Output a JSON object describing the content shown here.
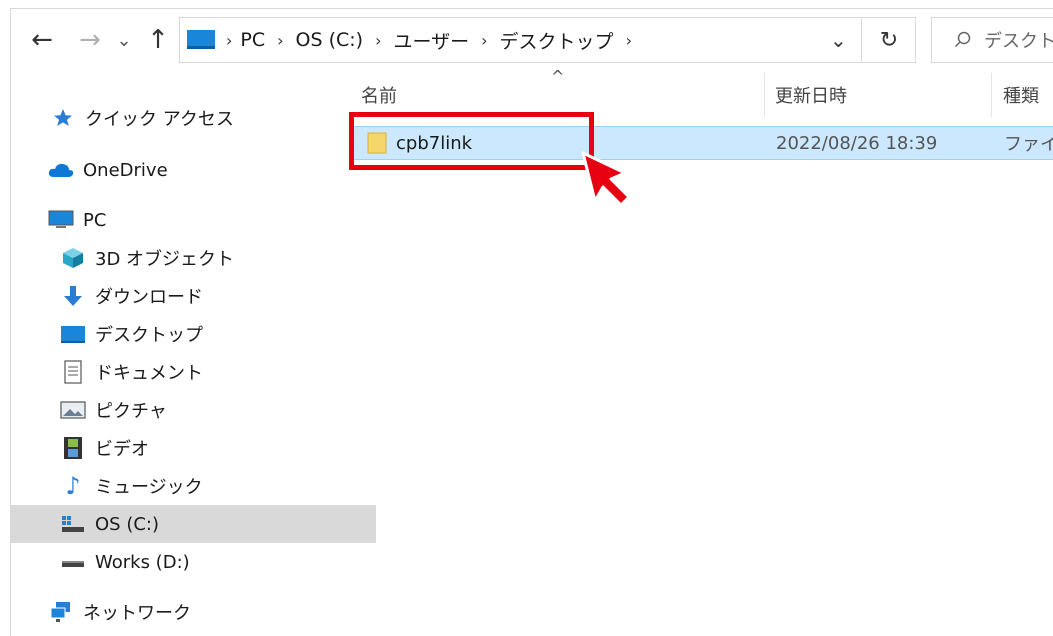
{
  "toolbar": {
    "back_label": "←",
    "forward_label": "→",
    "recent_label": "⌄",
    "up_label": "↑"
  },
  "address": {
    "crumbs": [
      "PC",
      "OS (C:)",
      "ユーザー",
      "デスクトップ"
    ],
    "dropdown_label": "⌄",
    "refresh_label": "↻"
  },
  "search": {
    "placeholder": "デスクト"
  },
  "sidebar": {
    "items": [
      {
        "label": "クイック アクセス"
      },
      {
        "label": "OneDrive"
      },
      {
        "label": "PC"
      },
      {
        "label": "3D オブジェクト"
      },
      {
        "label": "ダウンロード"
      },
      {
        "label": "デスクトップ"
      },
      {
        "label": "ドキュメント"
      },
      {
        "label": "ピクチャ"
      },
      {
        "label": "ビデオ"
      },
      {
        "label": "ミュージック"
      },
      {
        "label": "OS (C:)"
      },
      {
        "label": "Works (D:)"
      },
      {
        "label": "ネットワーク"
      }
    ]
  },
  "columns": {
    "name": "名前",
    "modified": "更新日時",
    "type": "種類",
    "sort_indicator": "^"
  },
  "files": [
    {
      "name": "cpb7link",
      "modified": "2022/08/26 18:39",
      "type": "ファイル"
    }
  ],
  "colors": {
    "selection": "#cce8ff",
    "highlight_box": "#e60012",
    "folder": "#f5d66a"
  }
}
